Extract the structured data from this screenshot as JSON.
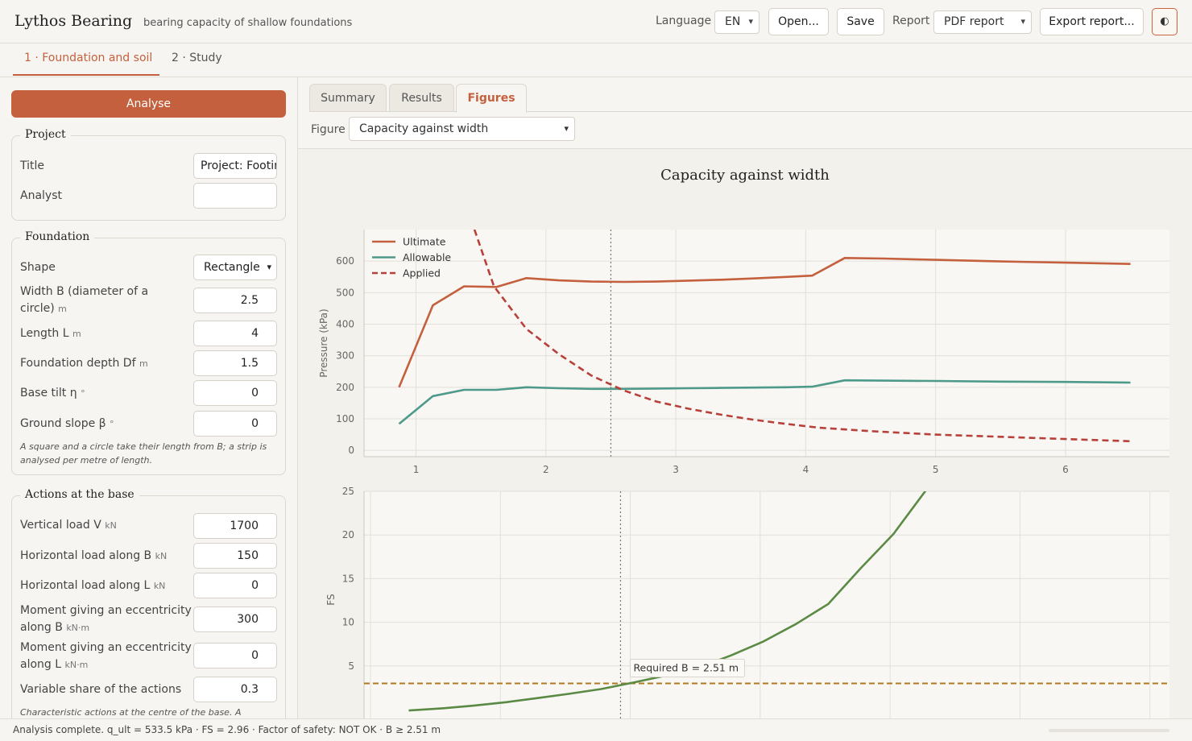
{
  "app": {
    "title": "Lythos Bearing",
    "subtitle": "bearing capacity of shallow foundations"
  },
  "header": {
    "language_label": "Language",
    "language_value": "EN",
    "open_label": "Open...",
    "save_label": "Save",
    "report_label": "Report",
    "report_value": "PDF report",
    "export_label": "Export report...",
    "theme_icon": "◐"
  },
  "steps": [
    {
      "label": "1 · Foundation and soil"
    },
    {
      "label": "2 · Study"
    }
  ],
  "left": {
    "analyse_label": "Analyse",
    "project": {
      "legend": "Project",
      "fields": [
        {
          "label": "Title",
          "value": "Project: Footing"
        },
        {
          "label": "Analyst",
          "value": ""
        }
      ]
    },
    "foundation": {
      "legend": "Foundation",
      "fields": [
        {
          "label": "Shape",
          "unit": "",
          "value": "Rectangle"
        },
        {
          "label": "Width B (diameter of a circle)",
          "unit": "m",
          "value": "2.5"
        },
        {
          "label": "Length L",
          "unit": "m",
          "value": "4"
        },
        {
          "label": "Foundation depth Df",
          "unit": "m",
          "value": "1.5"
        },
        {
          "label": "Base tilt η",
          "unit": "°",
          "value": "0"
        },
        {
          "label": "Ground slope β",
          "unit": "°",
          "value": "0"
        }
      ],
      "note": "A square and a circle take their length from B; a strip is analysed per metre of length."
    },
    "actions": {
      "legend": "Actions at the base",
      "fields": [
        {
          "label": "Vertical load V",
          "unit": "kN",
          "value": "1700"
        },
        {
          "label": "Horizontal load along B",
          "unit": "kN",
          "value": "150"
        },
        {
          "label": "Horizontal load along L",
          "unit": "kN",
          "value": "0"
        },
        {
          "label": "Moment giving an eccentricity along B",
          "unit": "kN·m",
          "value": "300"
        },
        {
          "label": "Moment giving an eccentricity along L",
          "unit": "kN·m",
          "value": "0"
        },
        {
          "label": "Variable share of the actions",
          "unit": "",
          "value": "0.3"
        }
      ],
      "note": "Characteristic actions at the centre of the base. A"
    }
  },
  "right": {
    "tabs": [
      {
        "label": "Summary"
      },
      {
        "label": "Results"
      },
      {
        "label": "Figures"
      }
    ],
    "figure_label": "Figure",
    "figure_value": "Capacity against width"
  },
  "chart_data": [
    {
      "type": "line",
      "title": "Capacity against width",
      "xlabel": "",
      "ylabel": "Pressure (kPa)",
      "xticks": [
        1,
        2,
        3,
        4,
        5,
        6
      ],
      "yticks": [
        0,
        100,
        200,
        300,
        400,
        500,
        600
      ],
      "xlim": [
        0.6,
        6.8
      ],
      "ylim": [
        -20,
        700
      ],
      "grid": true,
      "legend": "top-left",
      "marker_x": 2.5,
      "series": [
        {
          "name": "Ultimate",
          "color": "#c4603d",
          "style": "solid",
          "points": [
            [
              0.87,
              200
            ],
            [
              1.13,
              460
            ],
            [
              1.37,
              520
            ],
            [
              1.62,
              518
            ],
            [
              1.85,
              546
            ],
            [
              2.1,
              539
            ],
            [
              2.35,
              535
            ],
            [
              2.6,
              534
            ],
            [
              2.85,
              535
            ],
            [
              3.1,
              538
            ],
            [
              3.35,
              541
            ],
            [
              3.6,
              545
            ],
            [
              3.85,
              550
            ],
            [
              4.05,
              554
            ],
            [
              4.3,
              610
            ],
            [
              4.6,
              608
            ],
            [
              5.0,
              604
            ],
            [
              5.5,
              599
            ],
            [
              6.0,
              595
            ],
            [
              6.5,
              591
            ]
          ]
        },
        {
          "name": "Allowable",
          "color": "#4e9a8a",
          "style": "solid",
          "points": [
            [
              0.87,
              84
            ],
            [
              1.13,
              172
            ],
            [
              1.37,
              192
            ],
            [
              1.62,
              192
            ],
            [
              1.85,
              200
            ],
            [
              2.1,
              197
            ],
            [
              2.35,
              195
            ],
            [
              2.6,
              195
            ],
            [
              2.85,
              196
            ],
            [
              3.1,
              197
            ],
            [
              3.35,
              198
            ],
            [
              3.6,
              199
            ],
            [
              3.85,
              200
            ],
            [
              4.05,
              202
            ],
            [
              4.3,
              222
            ],
            [
              4.6,
              221
            ],
            [
              5.0,
              220
            ],
            [
              5.5,
              218
            ],
            [
              6.0,
              217
            ],
            [
              6.5,
              215
            ]
          ]
        },
        {
          "name": "Applied",
          "color": "#b8403a",
          "style": "dashed",
          "points": [
            [
              1.45,
              700
            ],
            [
              1.6,
              520
            ],
            [
              1.85,
              385
            ],
            [
              2.1,
              305
            ],
            [
              2.35,
              237
            ],
            [
              2.6,
              190
            ],
            [
              2.85,
              155
            ],
            [
              3.1,
              132
            ],
            [
              3.35,
              113
            ],
            [
              3.6,
              97
            ],
            [
              3.85,
              84
            ],
            [
              4.1,
              72
            ],
            [
              4.5,
              61
            ],
            [
              5.0,
              50
            ],
            [
              5.5,
              43
            ],
            [
              6.0,
              36
            ],
            [
              6.5,
              29
            ]
          ]
        }
      ]
    },
    {
      "type": "line",
      "title": "",
      "xlabel": "",
      "ylabel": "FS",
      "yticks": [
        5,
        10,
        15,
        20,
        25
      ],
      "ylim": [
        -1.2,
        25
      ],
      "grid": true,
      "marker_x": 2.5,
      "reference_line": {
        "y": 3,
        "color": "#b07a1f"
      },
      "annotation": "Required B = 2.51 m",
      "series": [
        {
          "name": "",
          "color": "#5a8a44",
          "style": "solid",
          "points": [
            [
              0.87,
              -0.1
            ],
            [
              1.13,
              0.15
            ],
            [
              1.37,
              0.45
            ],
            [
              1.62,
              0.85
            ],
            [
              1.85,
              1.3
            ],
            [
              2.1,
              1.8
            ],
            [
              2.35,
              2.35
            ],
            [
              2.6,
              3.1
            ],
            [
              2.85,
              3.9
            ],
            [
              3.1,
              4.8
            ],
            [
              3.35,
              6.2
            ],
            [
              3.6,
              7.8
            ],
            [
              3.85,
              9.8
            ],
            [
              4.1,
              12.1
            ],
            [
              4.35,
              16.2
            ],
            [
              4.6,
              20.1
            ],
            [
              4.85,
              25.1
            ]
          ]
        }
      ]
    }
  ],
  "status": {
    "text": "Analysis complete. q_ult = 533.5 kPa · FS = 2.96 · Factor of safety: NOT OK · B ≥ 2.51 m"
  }
}
